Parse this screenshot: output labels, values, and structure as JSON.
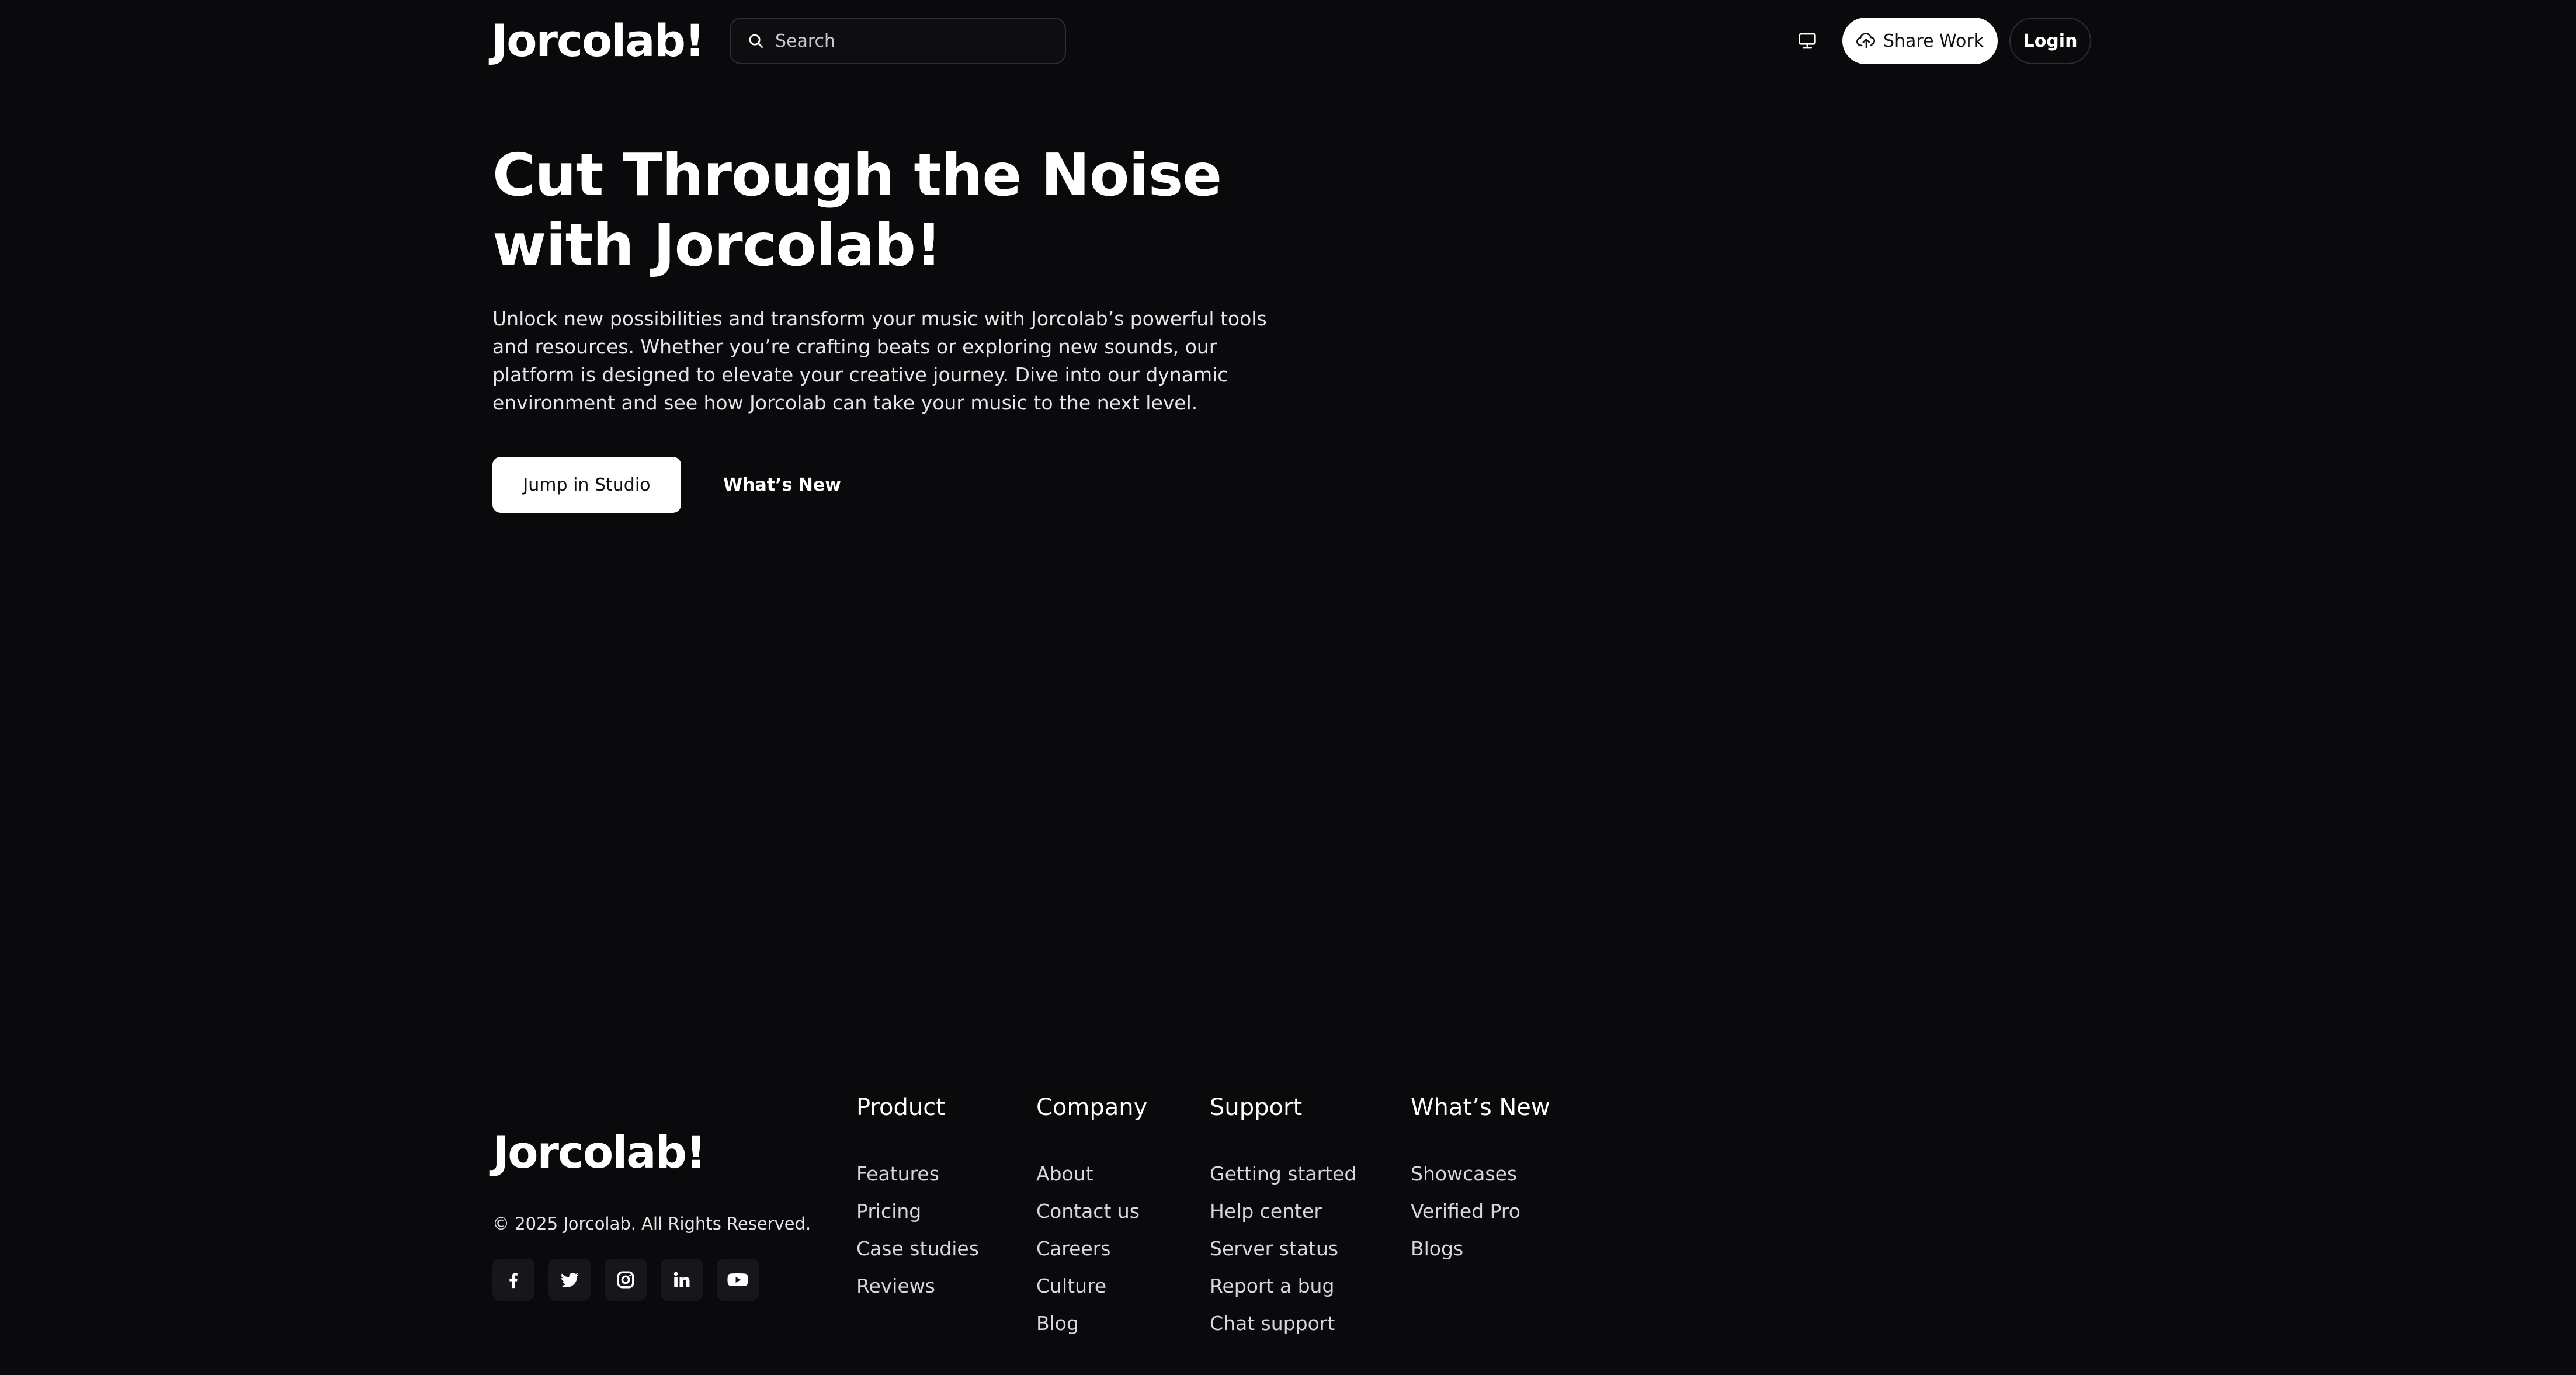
{
  "header": {
    "logo": "Jorcolab!",
    "search_placeholder": "Search",
    "share_label": "Share Work",
    "login_label": "Login"
  },
  "hero": {
    "title_line1": "Cut Through the Noise",
    "title_line2": "with Jorcolab!",
    "description": "Unlock new possibilities and transform your music with Jorcolab’s powerful tools and resources. Whether you’re crafting beats or exploring new sounds, our platform is designed to elevate your creative journey. Dive into our dynamic environment and see how Jorcolab can take your music to the next level.",
    "primary_button": "Jump in Studio",
    "secondary_button": "What’s New"
  },
  "footer": {
    "logo": "Jorcolab!",
    "copyright": "© 2025 Jorcolab. All Rights Reserved.",
    "socials": [
      "facebook-icon",
      "twitter-icon",
      "instagram-icon",
      "linkedin-icon",
      "youtube-icon"
    ],
    "columns": [
      {
        "title": "Product",
        "links": [
          "Features",
          "Pricing",
          "Case studies",
          "Reviews"
        ]
      },
      {
        "title": "Company",
        "links": [
          "About",
          "Contact us",
          "Careers",
          "Culture",
          "Blog"
        ]
      },
      {
        "title": "Support",
        "links": [
          "Getting started",
          "Help center",
          "Server status",
          "Report a bug",
          "Chat support"
        ]
      },
      {
        "title": "What’s New",
        "links": [
          "Showcases",
          "Verified Pro",
          "Blogs"
        ]
      }
    ]
  },
  "colors": {
    "background": "#0a0a0c",
    "text": "#ffffff",
    "button_light": "#ffffff",
    "border": "#2e2e33"
  }
}
